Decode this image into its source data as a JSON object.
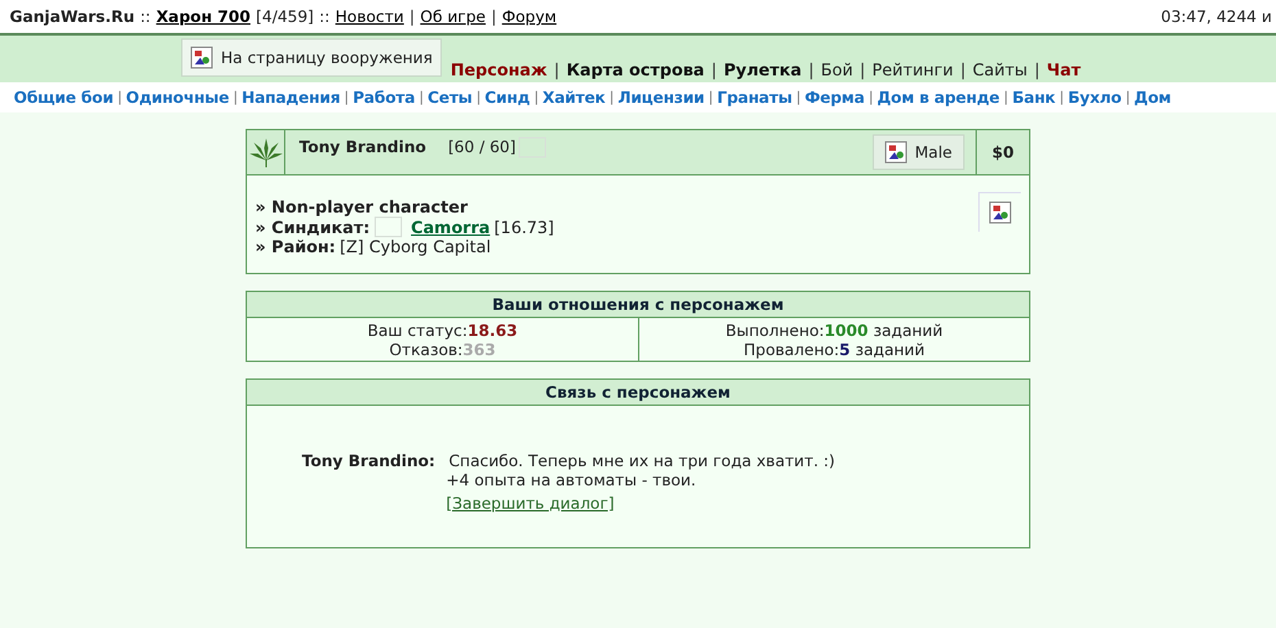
{
  "top_bar": {
    "site": "GanjaWars.Ru",
    "separator_1": "::",
    "server": "Харон 700",
    "online": "[4/459]",
    "separator_2": "::",
    "links": [
      "Новости",
      "Об игре",
      "Форум"
    ],
    "link_separator": "|",
    "clock": "03:47, 4244 и"
  },
  "menu": {
    "tooltip": "На страницу вооружения",
    "items": [
      {
        "label": "Персонаж",
        "kind": "accent"
      },
      {
        "label": "Карта острова",
        "kind": "bold"
      },
      {
        "label": "Рулетка",
        "kind": "bold"
      },
      {
        "label": "Бой",
        "kind": "normal"
      },
      {
        "label": "Рейтинги",
        "kind": "normal"
      },
      {
        "label": "Сайты",
        "kind": "normal"
      },
      {
        "label": "Чат",
        "kind": "accent"
      }
    ],
    "separator": "|"
  },
  "section_separator": "|",
  "sections": [
    "Общие бои",
    "Одиночные",
    "Нападения",
    "Работа",
    "Сеты",
    "Синд",
    "Хайтек",
    "Лицензии",
    "Гранаты",
    "Ферма",
    "Дом в аренде",
    "Банк",
    "Бухло",
    "Дом"
  ],
  "profile": {
    "name": "Tony Brandino",
    "hp": "[60 / 60]",
    "gender": "Male",
    "money": "$0",
    "lines": [
      {
        "label": "» Non-player character"
      },
      {
        "label": "» Синдикат:",
        "link": "Camorra",
        "value": "[16.73]"
      },
      {
        "label": "» Район:",
        "value": "[Z] Cyborg Capital"
      }
    ]
  },
  "relations": {
    "title": "Ваши отношения с персонажем",
    "status_label": "Ваш статус:",
    "status": "18.63",
    "refusals_label": "Отказов:",
    "refusals": "363",
    "done_label": "Выполнено:",
    "done": "1000",
    "done_unit": "заданий",
    "failed_label": "Провалено:",
    "failed": "5",
    "failed_unit": "заданий"
  },
  "dialog": {
    "title": "Связь с персонажем",
    "speaker": "Tony Brandino:",
    "lines": [
      "Спасибо. Теперь мне их на три года хватит. :)",
      "+4 опыта на автоматы - твои."
    ],
    "end_link": "[Завершить диалог]"
  }
}
